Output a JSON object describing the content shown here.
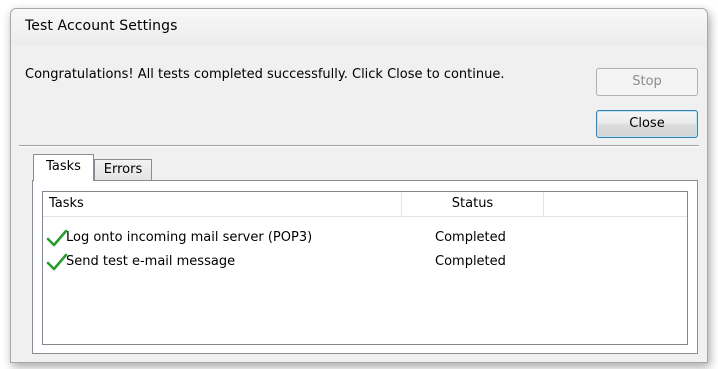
{
  "window": {
    "title": "Test Account Settings"
  },
  "message": "Congratulations! All tests completed successfully. Click Close to continue.",
  "buttons": {
    "stop_label": "Stop",
    "close_label": "Close"
  },
  "tabs": [
    {
      "label": "Tasks",
      "active": true
    },
    {
      "label": "Errors",
      "active": false
    }
  ],
  "table": {
    "columns": [
      "Tasks",
      "Status"
    ],
    "rows": [
      {
        "task": "Log onto incoming mail server (POP3)",
        "status": "Completed",
        "icon": "check-icon"
      },
      {
        "task": "Send test e-mail message",
        "status": "Completed",
        "icon": "check-icon"
      }
    ]
  },
  "colors": {
    "check": "#2e9b2e",
    "default_button_border": "#3c7fb1"
  }
}
